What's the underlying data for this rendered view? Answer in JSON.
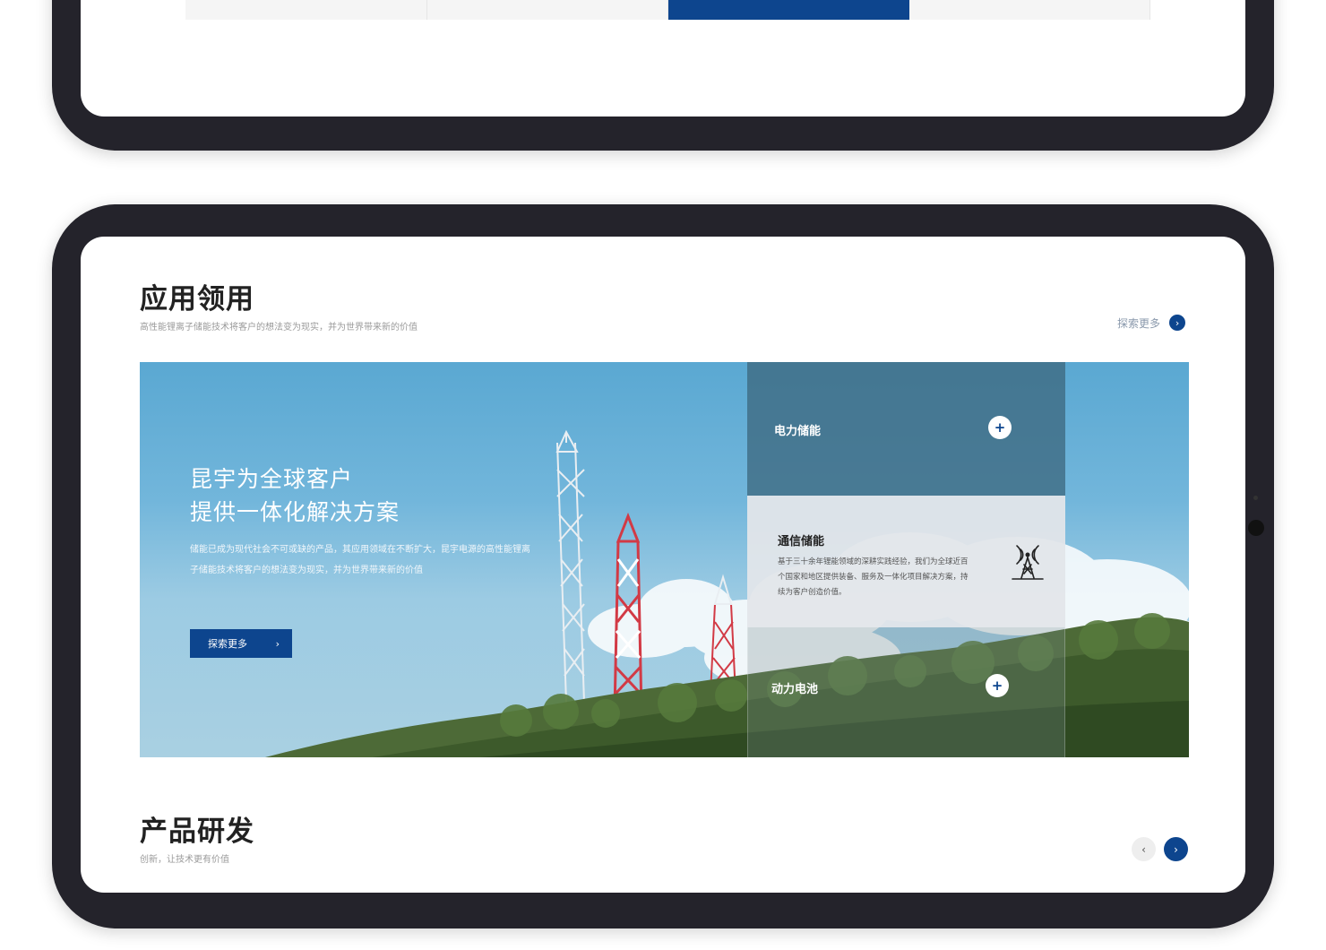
{
  "top_cards": [
    {
      "arrow": "→",
      "active": false
    },
    {
      "arrow": "→",
      "active": false
    },
    {
      "arrow": "→",
      "active": true
    },
    {
      "arrow": "→",
      "active": false
    }
  ],
  "applications": {
    "title": "应用领用",
    "subtitle": "高性能锂离子储能技术将客户的想法变为现实，并为世界带来新的价值",
    "explore_label": "探索更多",
    "explore_icon": "›",
    "banner": {
      "headline": "昆宇为全球客户\n提供一体化解决方案",
      "description": "储能已成为现代社会不可或缺的产品，其应用领域在不断扩大，昆宇电源的高性能锂离子储能技术将客户的想法变为现实，并为世界带来新的价值",
      "button_label": "探索更多",
      "button_icon": "›"
    },
    "panels": [
      {
        "title": "电力储能",
        "icon": "+"
      },
      {
        "title": "通信储能",
        "description": "基于三十余年锂能领域的深耕实践经验，我们为全球近百个国家和地区提供装备、服务及一体化项目解决方案，持续为客户创造价值。",
        "icon": "signal-tower-icon"
      },
      {
        "title": "动力电池",
        "icon": "+"
      }
    ]
  },
  "products": {
    "title": "产品研发",
    "subtitle": "创新，让技术更有价值",
    "prev_icon": "‹",
    "next_icon": "›"
  },
  "colors": {
    "brand_blue": "#0d458e",
    "device_frame": "#24232b",
    "card_bg": "#f5f5f5"
  }
}
